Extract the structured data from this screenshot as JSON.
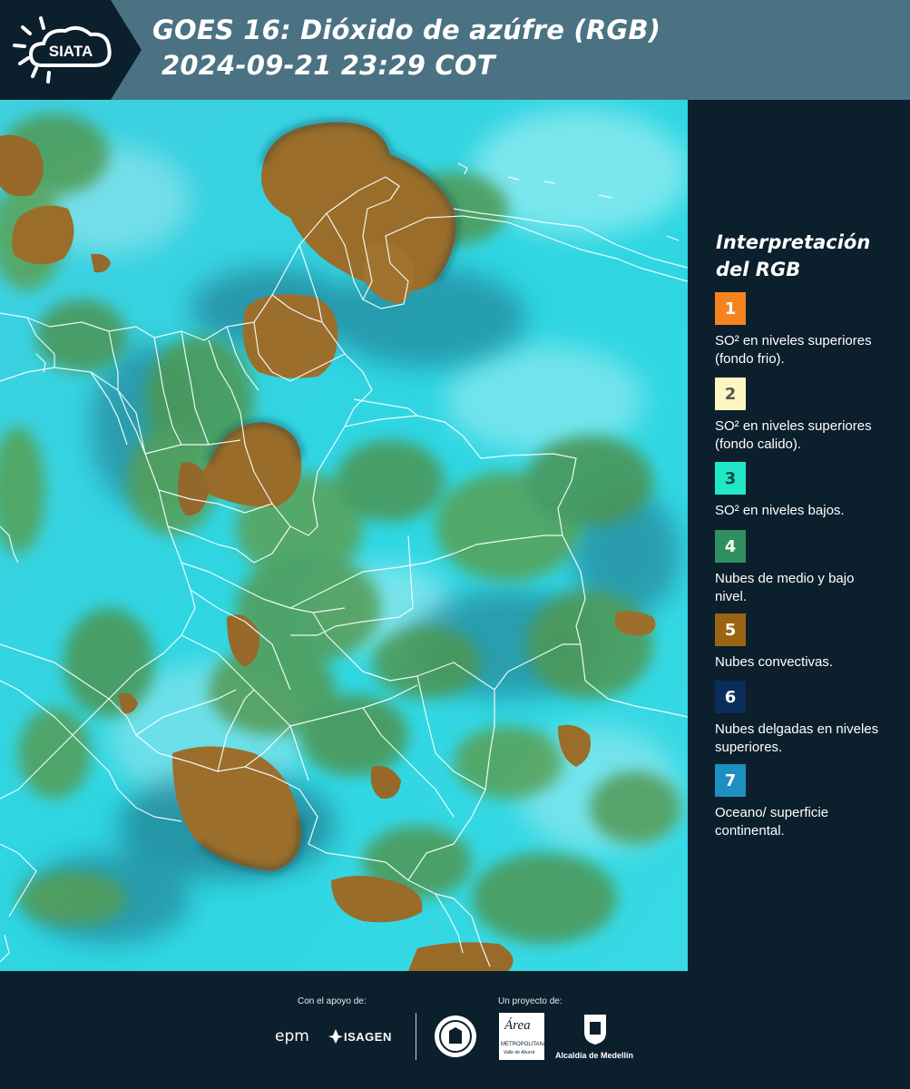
{
  "header": {
    "logo_text": "SIATA",
    "title_line1": "GOES 16: Dióxido de azúfre (RGB)",
    "title_line2": "2024-09-21 23:29 COT"
  },
  "legend": {
    "title_line1": "Interpretación",
    "title_line2": "del RGB",
    "items": [
      {
        "number": "1",
        "label": "SO² en niveles superiores (fondo frio).",
        "color": "#f5841f",
        "text_color": "#ffffff"
      },
      {
        "number": "2",
        "label": "SO² en niveles superiores (fondo calido).",
        "color": "#fdf6c3",
        "text_color": "#555555"
      },
      {
        "number": "3",
        "label": "SO² en niveles bajos.",
        "color": "#20e8c8",
        "text_color": "#0b4a44"
      },
      {
        "number": "4",
        "label": "Nubes de medio y bajo nivel.",
        "color": "#2f8f5e",
        "text_color": "#ffffff"
      },
      {
        "number": "5",
        "label": "Nubes convectivas.",
        "color": "#9a6412",
        "text_color": "#ffffff"
      },
      {
        "number": "6",
        "label": "Nubes delgadas en niveles superiores.",
        "color": "#0b2d5c",
        "text_color": "#ffffff"
      },
      {
        "number": "7",
        "label": "Oceano/ superficie continental.",
        "color": "#1d8fc0",
        "text_color": "#ffffff"
      }
    ]
  },
  "footer": {
    "support_label": "Con el apoyo de:",
    "project_label": "Un proyecto de:",
    "epm": "epm",
    "isagen": "ISAGEN",
    "area_name": "Área",
    "area_sub1": "METROPOLITANA",
    "area_sub2": "Valle de Aburrá",
    "alcaldia": "Alcaldía de Medellín"
  },
  "colors": {
    "header_bg": "#4b7283",
    "panel_bg": "#0b1f2c",
    "map_cyan": "#2fd4e0",
    "convective_brown": "#9a6d2a",
    "mid_cloud_green": "#4e9a52"
  }
}
